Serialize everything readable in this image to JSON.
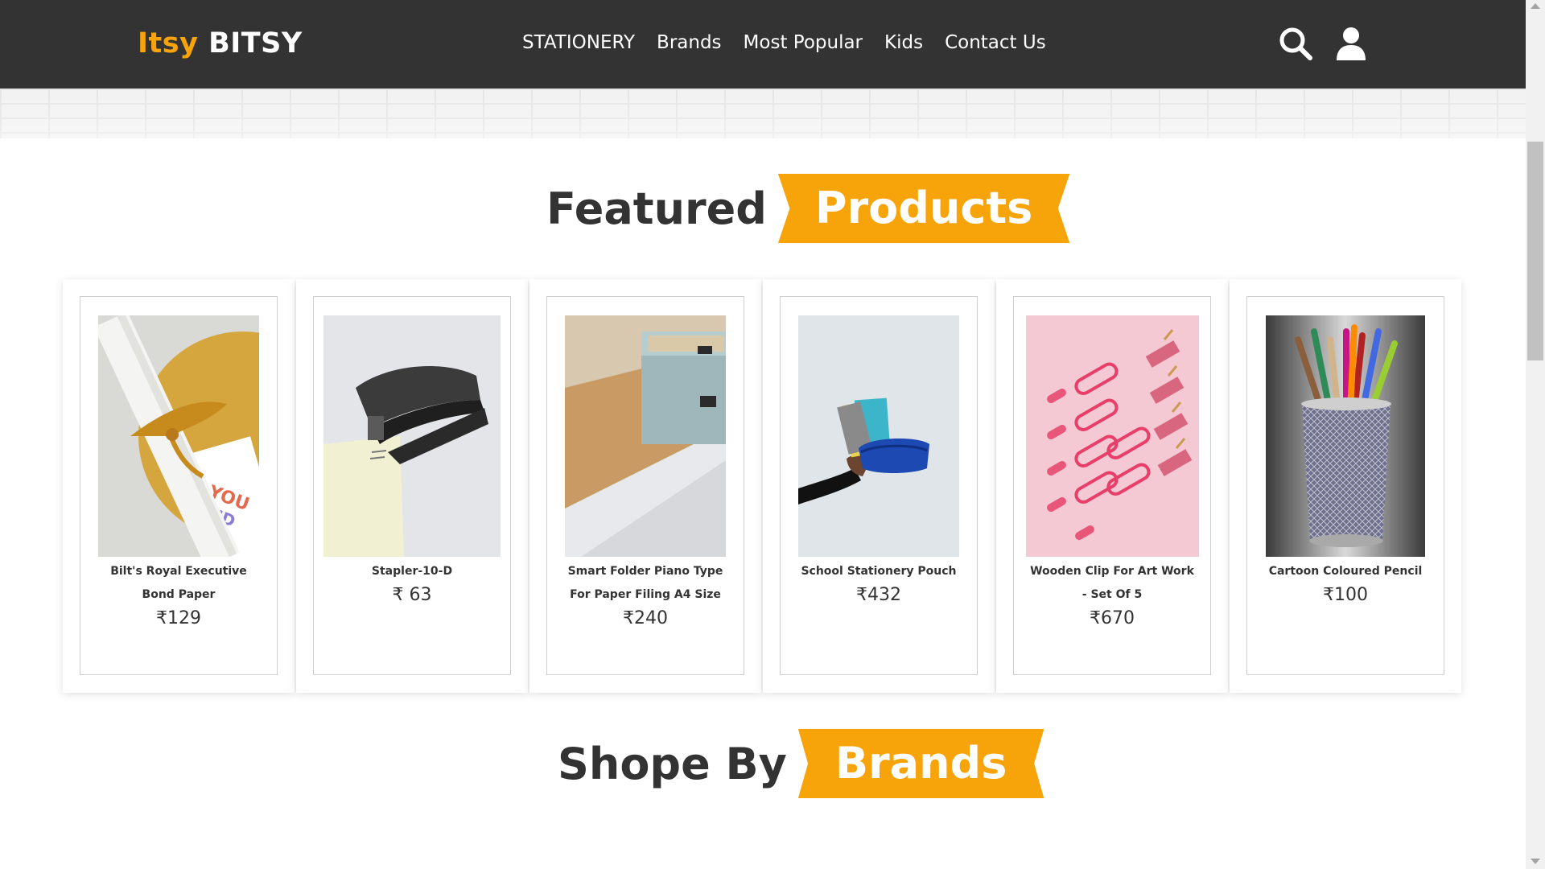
{
  "brand": {
    "first": "Itsy",
    "second": "BITSY",
    "accent": "#f7a30a",
    "nav_bg": "#333333"
  },
  "nav": {
    "items": [
      "STATIONERY",
      "Brands",
      "Most Popular",
      "Kids",
      "Contact Us"
    ]
  },
  "icons": {
    "search": "search-icon",
    "user": "user-icon"
  },
  "featured": {
    "plain": "Featured",
    "highlight": "Products"
  },
  "products": [
    {
      "title": "Bilt's Royal Executive Bond Paper",
      "price": "₹129",
      "image": "rolled-paper-with-gold-ribbon"
    },
    {
      "title": "Stapler-10-D",
      "price": "₹ 63",
      "image": "black-stapler"
    },
    {
      "title": "Smart Folder Piano Type For Paper Filing A4 Size",
      "price": "₹240",
      "image": "file-box-on-desk"
    },
    {
      "title": "School Stationery Pouch",
      "price": "₹432",
      "image": "hand-holding-pouch"
    },
    {
      "title": "Wooden Clip For Art Work - Set Of 5",
      "price": "₹670",
      "image": "pink-clips-and-pins"
    },
    {
      "title": "Cartoon Coloured Pencil",
      "price": "₹100",
      "image": "pencils-in-mesh-cup"
    }
  ],
  "brands_heading": {
    "plain": "Shope By",
    "highlight": "Brands"
  }
}
